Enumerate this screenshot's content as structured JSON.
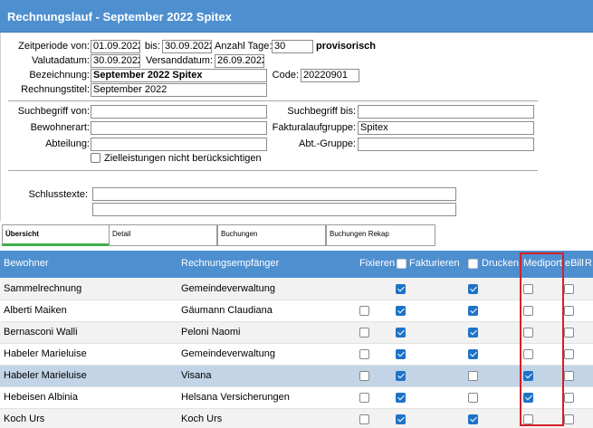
{
  "window": {
    "title": "Rechnungslauf - September 2022 Spitex"
  },
  "form": {
    "zeitperiode_von_label": "Zeitperiode von:",
    "zeitperiode_von": "01.09.2022",
    "bis_label": "bis:",
    "bis": "30.09.2022",
    "anzahl_tage_label": "Anzahl Tage:",
    "anzahl_tage": "30",
    "status": "provisorisch",
    "valutadatum_label": "Valutadatum:",
    "valutadatum": "30.09.2022",
    "versanddatum_label": "Versanddatum:",
    "versanddatum": "26.09.2022",
    "bezeichnung_label": "Bezeichnung:",
    "bezeichnung": "September 2022 Spitex",
    "code_label": "Code:",
    "code": "20220901",
    "rechnungstitel_label": "Rechnungstitel:",
    "rechnungstitel": "September 2022",
    "suchbegriff_von_label": "Suchbegriff von:",
    "suchbegriff_von": "",
    "suchbegriff_bis_label": "Suchbegriff bis:",
    "suchbegriff_bis": "",
    "bewohnerart_label": "Bewohnerart:",
    "bewohnerart": "",
    "fakturalaufgruppe_label": "Fakturalaufgruppe:",
    "fakturalaufgruppe": "Spitex",
    "abteilung_label": "Abteilung:",
    "abteilung": "",
    "abt_gruppe_label": "Abt.-Gruppe:",
    "abt_gruppe": "",
    "zielleistungen_label": "Zielleistungen nicht berücksichtigen",
    "schlusstexte_label": "Schlusstexte:",
    "schlusstexte_1": "",
    "schlusstexte_2": ""
  },
  "tabs": [
    {
      "label": "Übersicht",
      "active": true
    },
    {
      "label": "Detail",
      "active": false
    },
    {
      "label": "Buchungen",
      "active": false
    },
    {
      "label": "Buchungen Rekap",
      "active": false
    }
  ],
  "grid": {
    "columns": {
      "bewohner": "Bewohner",
      "rechnungsempfaenger": "Rechnungsempfänger",
      "fixieren": "Fixieren",
      "fakturieren": "Fakturieren",
      "drucken": "Drucken",
      "mediport": "Mediport",
      "ebill": "eBill",
      "r": "R"
    },
    "rows": [
      {
        "bewohner": "Sammelrechnung",
        "empfaenger": "Gemeindeverwaltung",
        "fixieren": null,
        "fakturieren": true,
        "drucken": true,
        "mediport": false,
        "ebill": false
      },
      {
        "bewohner": "Alberti Maiken",
        "empfaenger": "Gäumann Claudiana",
        "fixieren": false,
        "fakturieren": true,
        "drucken": true,
        "mediport": false,
        "ebill": false
      },
      {
        "bewohner": "Bernasconi Walli",
        "empfaenger": "Peloni Naomi",
        "fixieren": false,
        "fakturieren": true,
        "drucken": true,
        "mediport": false,
        "ebill": false
      },
      {
        "bewohner": "Habeler Marieluise",
        "empfaenger": "Gemeindeverwaltung",
        "fixieren": false,
        "fakturieren": true,
        "drucken": true,
        "mediport": false,
        "ebill": false
      },
      {
        "bewohner": "Habeler Marieluise",
        "empfaenger": "Visana",
        "fixieren": false,
        "fakturieren": true,
        "drucken": false,
        "mediport": true,
        "ebill": false,
        "selected": true
      },
      {
        "bewohner": "Hebeisen Albinia",
        "empfaenger": "Helsana Versicherungen",
        "fixieren": false,
        "fakturieren": true,
        "drucken": false,
        "mediport": true,
        "ebill": false
      },
      {
        "bewohner": "Koch Urs",
        "empfaenger": "Koch Urs",
        "fixieren": false,
        "fakturieren": true,
        "drucken": true,
        "mediport": false,
        "ebill": false
      }
    ]
  },
  "colors": {
    "accent": "#4e8fd0",
    "checked": "#1e73c7",
    "highlight": "#d4202a",
    "selected_row": "#c2d4e6",
    "alt_row": "#f2f2f2"
  }
}
